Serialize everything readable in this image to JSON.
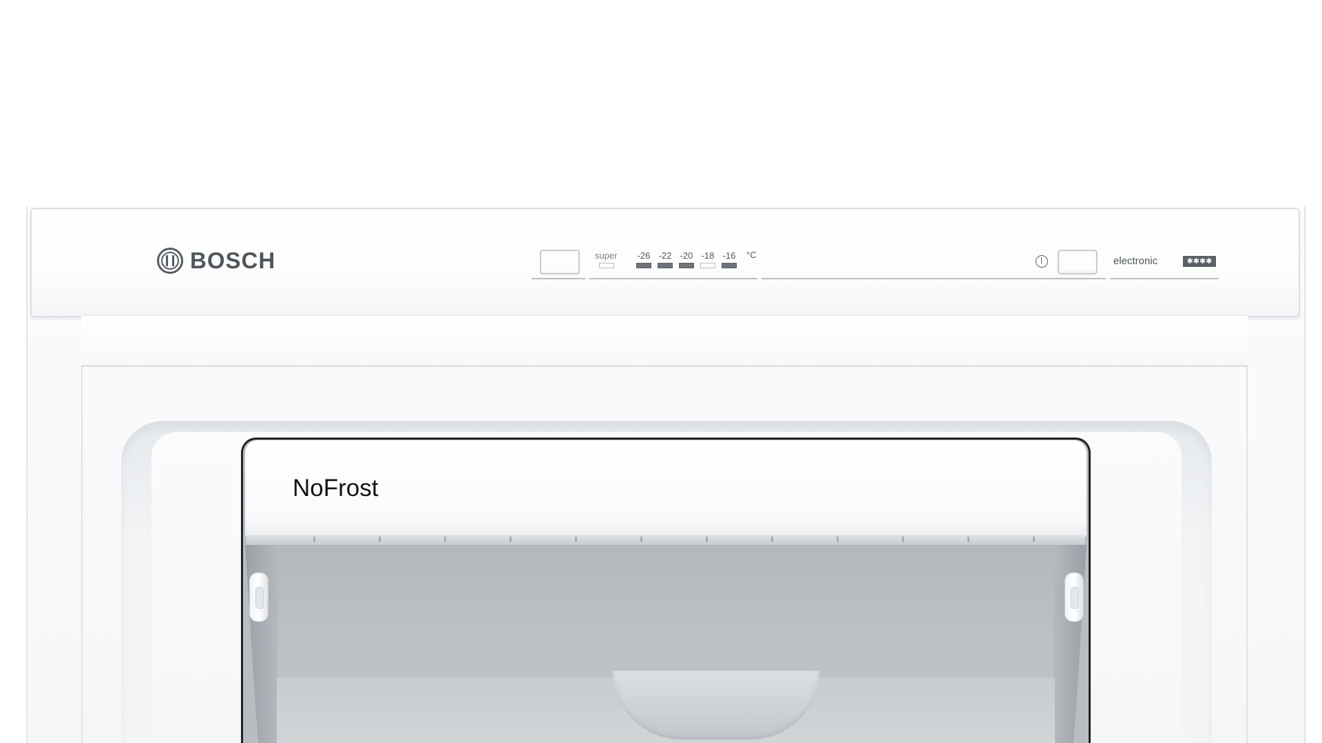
{
  "brand": {
    "name": "BOSCH"
  },
  "control_panel": {
    "super_label": "super",
    "temperatures": [
      {
        "label": "-26",
        "led": "on"
      },
      {
        "label": "-22",
        "led": "on"
      },
      {
        "label": "-20",
        "led": "on"
      },
      {
        "label": "-18",
        "led": "off"
      },
      {
        "label": "-16",
        "led": "on"
      }
    ],
    "unit": "°C",
    "mode_label": "electronic",
    "star_rating": "✱✱✱✱"
  },
  "compartment": {
    "label": "NoFrost"
  },
  "colors": {
    "panel_text": "#50565c",
    "led_on": "#6f747a",
    "compartment_interior": "#b9bdc1"
  }
}
